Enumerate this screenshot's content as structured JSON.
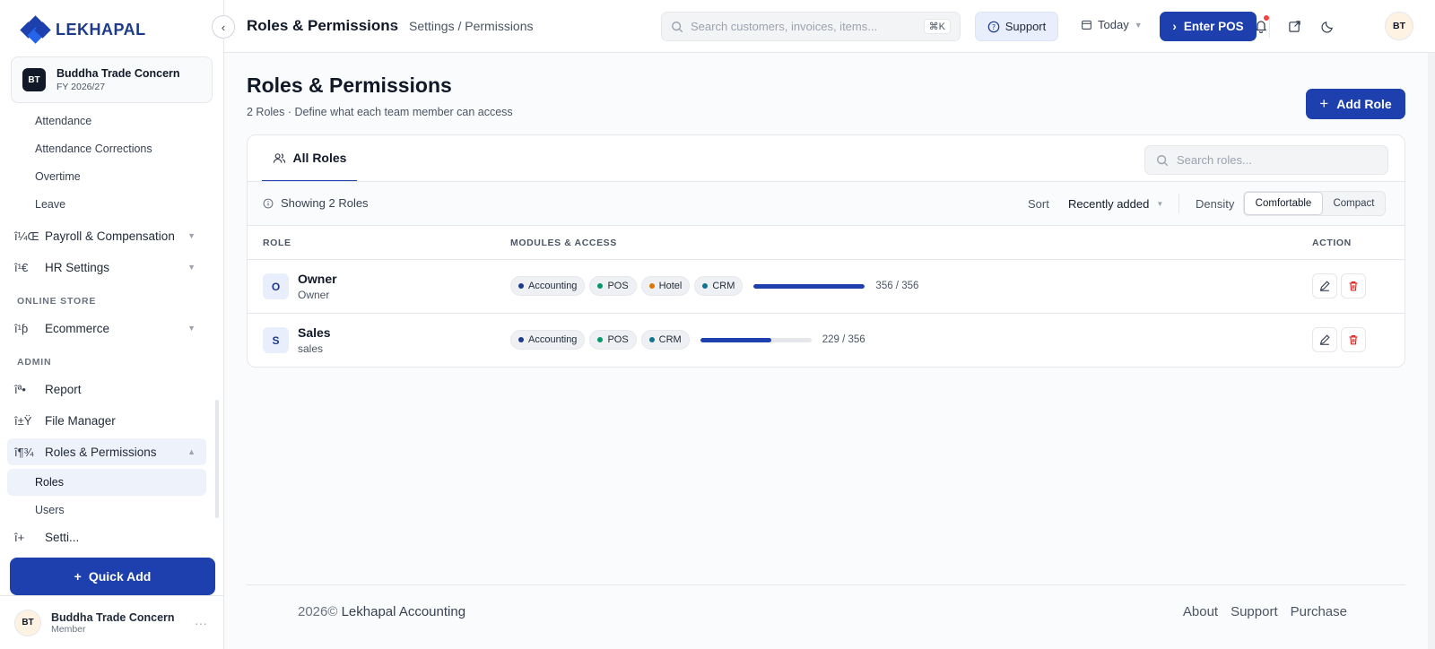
{
  "app": {
    "brand": "LEKHAPAL",
    "brand_color": "#1e40af"
  },
  "sidebar": {
    "org": {
      "initials": "BT",
      "name": "Buddha Trade Concern",
      "fy": "FY 2026/27"
    },
    "sub_items_top": [
      "Attendance",
      "Attendance Corrections",
      "Overtime",
      "Leave"
    ],
    "payroll": {
      "glyph": "î¼Œ",
      "label": "Payroll & Compensation"
    },
    "hr_settings": {
      "glyph": "î¹€",
      "label": "HR Settings"
    },
    "section_store": "ONLINE STORE",
    "ecommerce": {
      "glyph": "î¹ƥ",
      "label": "Ecommerce"
    },
    "section_admin": "ADMIN",
    "report": {
      "glyph": "îª•",
      "label": "Report"
    },
    "file_manager": {
      "glyph": "î±Ÿ",
      "label": "File Manager"
    },
    "roles_permissions": {
      "glyph": "î¶¾",
      "label": "Roles & Permissions"
    },
    "sub_roles": "Roles",
    "sub_users": "Users",
    "partial_item": {
      "glyph": "î+",
      "label": "Setti..."
    },
    "quick_add": "Quick Add",
    "user": {
      "initials": "BT",
      "name": "Buddha Trade Concern",
      "role": "Member"
    }
  },
  "topbar": {
    "title": "Roles & Permissions",
    "breadcrumb": "Settings / Permissions",
    "search_placeholder": "Search customers, invoices, items...",
    "shortcut": "⌘K",
    "support": "Support",
    "date_filter": "Today",
    "enter_pos": "Enter POS",
    "avatar": "BT"
  },
  "page": {
    "title": "Roles & Permissions",
    "subtitle": "2 Roles · Define what each team member can access",
    "add_role": "Add Role"
  },
  "card": {
    "tab_all": "All Roles",
    "search_placeholder": "Search roles...",
    "showing": "Showing 2 Roles",
    "sort_label": "Sort",
    "sort_value": "Recently added",
    "density_label": "Density",
    "density_on": "Comfortable",
    "density_off": "Compact",
    "columns": {
      "role": "ROLE",
      "modules": "MODULES & ACCESS",
      "action": "ACTION"
    },
    "rows": [
      {
        "initial": "O",
        "name": "Owner",
        "slug": "Owner",
        "modules": [
          {
            "label": "Accounting",
            "color": "#1e3a8a"
          },
          {
            "label": "POS",
            "color": "#059669"
          },
          {
            "label": "Hotel",
            "color": "#d97706"
          },
          {
            "label": "CRM",
            "color": "#0e7490"
          }
        ],
        "granted": 356,
        "total": 356,
        "count": "356 / 356"
      },
      {
        "initial": "S",
        "name": "Sales",
        "slug": "sales",
        "modules": [
          {
            "label": "Accounting",
            "color": "#1e3a8a"
          },
          {
            "label": "POS",
            "color": "#059669"
          },
          {
            "label": "CRM",
            "color": "#0e7490"
          }
        ],
        "granted": 229,
        "total": 356,
        "count": "229 / 356"
      }
    ]
  },
  "footer": {
    "year": "2026©",
    "company": "Lekhapal Accounting",
    "links": [
      "About",
      "Support",
      "Purchase"
    ]
  }
}
